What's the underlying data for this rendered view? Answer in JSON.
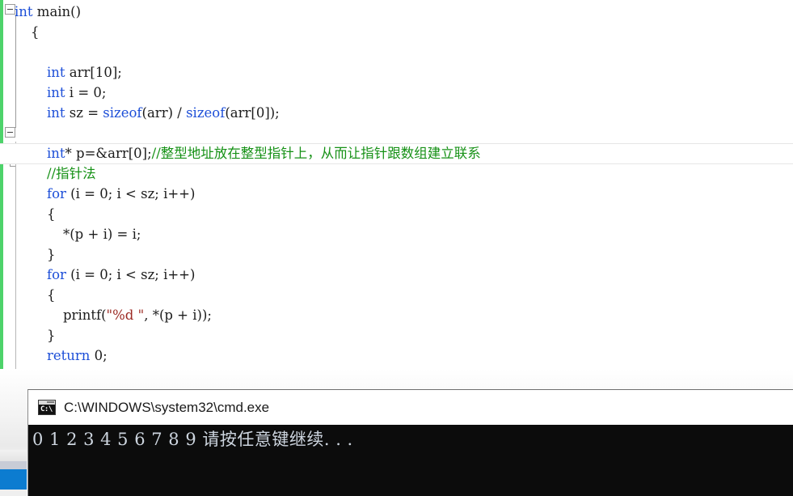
{
  "editor": {
    "name": "code-editor",
    "change_bar_color": "#4dd36a",
    "syntax_colors": {
      "keyword": "#1d4fd8",
      "comment": "#169116",
      "string": "#9c2a23",
      "plain": "#1c1c1c"
    },
    "lines": [
      {
        "indent": 0,
        "fold": "minus",
        "segments": [
          {
            "t": "int",
            "c": "kw"
          },
          {
            "t": " main()",
            "c": "pun"
          }
        ]
      },
      {
        "indent": 1,
        "fold": "",
        "segments": [
          {
            "t": "{",
            "c": "pun"
          }
        ]
      },
      {
        "indent": 0,
        "fold": "",
        "segments": []
      },
      {
        "indent": 2,
        "fold": "",
        "segments": [
          {
            "t": "int",
            "c": "kw"
          },
          {
            "t": " arr[10];",
            "c": "pun"
          }
        ]
      },
      {
        "indent": 2,
        "fold": "",
        "segments": [
          {
            "t": "int",
            "c": "kw"
          },
          {
            "t": " i = 0;",
            "c": "pun"
          }
        ]
      },
      {
        "indent": 2,
        "fold": "",
        "segments": [
          {
            "t": "int",
            "c": "kw"
          },
          {
            "t": " sz = ",
            "c": "pun"
          },
          {
            "t": "sizeof",
            "c": "kw"
          },
          {
            "t": "(arr) / ",
            "c": "pun"
          },
          {
            "t": "sizeof",
            "c": "kw"
          },
          {
            "t": "(arr[0]);",
            "c": "pun"
          }
        ]
      },
      {
        "indent": 0,
        "fold": "",
        "segments": []
      },
      {
        "indent": 2,
        "fold": "minus",
        "current": true,
        "segments": [
          {
            "t": "int",
            "c": "kw"
          },
          {
            "t": "* p=&arr[0];",
            "c": "pun"
          },
          {
            "t": "//整型地址放在整型指针上，从而让指针跟数组建立联系",
            "c": "cmt"
          }
        ]
      },
      {
        "indent": 2,
        "fold": "",
        "segments": [
          {
            "t": "//指针法",
            "c": "cmt"
          }
        ]
      },
      {
        "indent": 2,
        "fold": "tick",
        "segments": [
          {
            "t": "for",
            "c": "kw"
          },
          {
            "t": " (i = 0; i < sz; i++)",
            "c": "pun"
          }
        ]
      },
      {
        "indent": 2,
        "fold": "",
        "segments": [
          {
            "t": "{",
            "c": "pun"
          }
        ]
      },
      {
        "indent": 3,
        "fold": "",
        "segments": [
          {
            "t": "*(p + i) = i;",
            "c": "pun"
          }
        ]
      },
      {
        "indent": 2,
        "fold": "",
        "segments": [
          {
            "t": "}",
            "c": "pun"
          }
        ]
      },
      {
        "indent": 2,
        "fold": "",
        "segments": [
          {
            "t": "for",
            "c": "kw"
          },
          {
            "t": " (i = 0; i < sz; i++)",
            "c": "pun"
          }
        ]
      },
      {
        "indent": 2,
        "fold": "",
        "segments": [
          {
            "t": "{",
            "c": "pun"
          }
        ]
      },
      {
        "indent": 3,
        "fold": "",
        "segments": [
          {
            "t": "printf(",
            "c": "pun"
          },
          {
            "t": "\"%d \"",
            "c": "str"
          },
          {
            "t": ", *(p + i));",
            "c": "pun"
          }
        ]
      },
      {
        "indent": 2,
        "fold": "",
        "segments": [
          {
            "t": "}",
            "c": "pun"
          }
        ]
      },
      {
        "indent": 2,
        "fold": "",
        "segments": [
          {
            "t": "return",
            "c": "kw"
          },
          {
            "t": " 0;",
            "c": "pun"
          }
        ]
      },
      {
        "indent": 1,
        "fold": "",
        "segments": [
          {
            "t": "}",
            "c": "pun"
          }
        ]
      }
    ],
    "full_text": "int main()\n{\n\n    int arr[10];\n    int i = 0;\n    int sz = sizeof(arr) / sizeof(arr[0]);\n\n    int* p=&arr[0];//整型地址放在整型指针上，从而让指针跟数组建立联系\n    //指针法\n    for (i = 0; i < sz; i++)\n    {\n        *(p + i) = i;\n    }\n    for (i = 0; i < sz; i++)\n    {\n        printf(\"%d \", *(p + i));\n    }\n    return 0;\n}"
  },
  "console": {
    "title": "C:\\WINDOWS\\system32\\cmd.exe",
    "icon": "cmd-console-icon",
    "icon_prompt_text": "C:\\",
    "background_color": "#0c0c0c",
    "text_color": "#cdd5df",
    "output_lines": [
      "0 1 2 3 4 5 6 7 8 9 请按任意键继续. . ."
    ]
  },
  "taskbar": {
    "name": "taskbar-edge",
    "accent_color": "#0c7cd0"
  }
}
